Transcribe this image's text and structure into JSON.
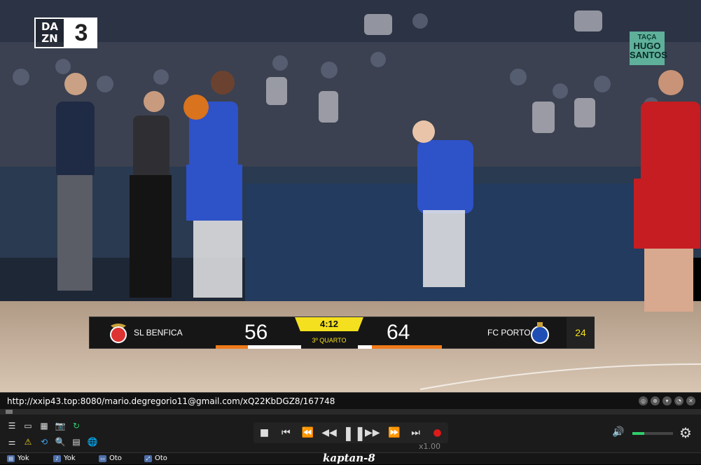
{
  "video": {
    "channel_logo": {
      "brand": "DAZN",
      "number": "3"
    },
    "tournament_logo": [
      "TAÇA",
      "HUGO",
      "SANTOS"
    ],
    "scoreboard": {
      "home_team": "SL BENFICA",
      "home_score": "56",
      "away_team": "FC PORTO",
      "away_score": "64",
      "clock": "4:12",
      "period": "3º QUARTO",
      "shot_clock": "24",
      "colors": {
        "clock_bg": "#f4e01e",
        "bar": "#f07a1a",
        "bg": "#161616"
      }
    }
  },
  "player": {
    "url": "http://xxip43.top:8080/mario.degregorio11@gmail.com/xQ22KbDGZ8/167748",
    "speed": "x1.00",
    "brand": "kaptan-8",
    "volume_level": 0.3,
    "accent": "#2fce6b",
    "status_items": [
      {
        "icon": "subtitle-icon",
        "label": "Yok"
      },
      {
        "icon": "audio-track-icon",
        "label": "Yok"
      },
      {
        "icon": "aspect-ratio-icon",
        "label": "Oto"
      },
      {
        "icon": "video-size-icon",
        "label": "Oto"
      }
    ]
  }
}
